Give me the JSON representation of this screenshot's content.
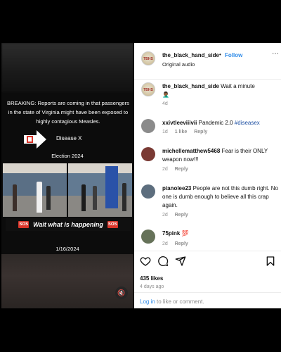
{
  "video": {
    "breaking_text": "BREAKING: Reports are coming in that passengers in the state of Virginia might have been exposed to highly contagious Measles.",
    "disease_label": "Disease X",
    "election_label": "Election 2024",
    "caption_badge_left": "SOS",
    "caption_text": "Wait what is happening",
    "caption_badge_right": "SOS",
    "date": "1/16/2024",
    "mute_icon": "speaker-muted-icon"
  },
  "post": {
    "username": "the_black_hand_side",
    "separator": "•",
    "follow_label": "Follow",
    "audio": "Original audio",
    "more_icon": "more-icon",
    "caption_user": "the_black_hand_side",
    "caption_text": "Wait a minute",
    "caption_emoji": "🤦🏾‍♂️",
    "caption_age": "4d"
  },
  "comments": [
    {
      "user": "xxivtleeviiivii",
      "text": "Pandemic 2.0",
      "hashtag": "#diseasex",
      "age": "1d",
      "likes": "1 like",
      "reply": "Reply"
    },
    {
      "user": "michellematthew5468",
      "text": "Fear is their ONLY weapon now!!!",
      "age": "2d",
      "reply": "Reply"
    },
    {
      "user": "pianolee23",
      "text": "People are not this dumb right. No one is dumb enough to believe all this crap again.",
      "age": "2d",
      "reply": "Reply"
    },
    {
      "user": "75pink",
      "text": "💯",
      "age": "2d",
      "reply": "Reply"
    }
  ],
  "footer": {
    "icons": [
      "heart-icon",
      "comment-icon",
      "share-icon",
      "bookmark-icon"
    ],
    "likes": "435 likes",
    "ago": "4 days ago",
    "login_link": "Log in",
    "login_rest": " to like or comment."
  },
  "colors": {
    "accent": "#2f8be8",
    "hashtag": "#1e50a2",
    "sos": "#d8352a"
  }
}
